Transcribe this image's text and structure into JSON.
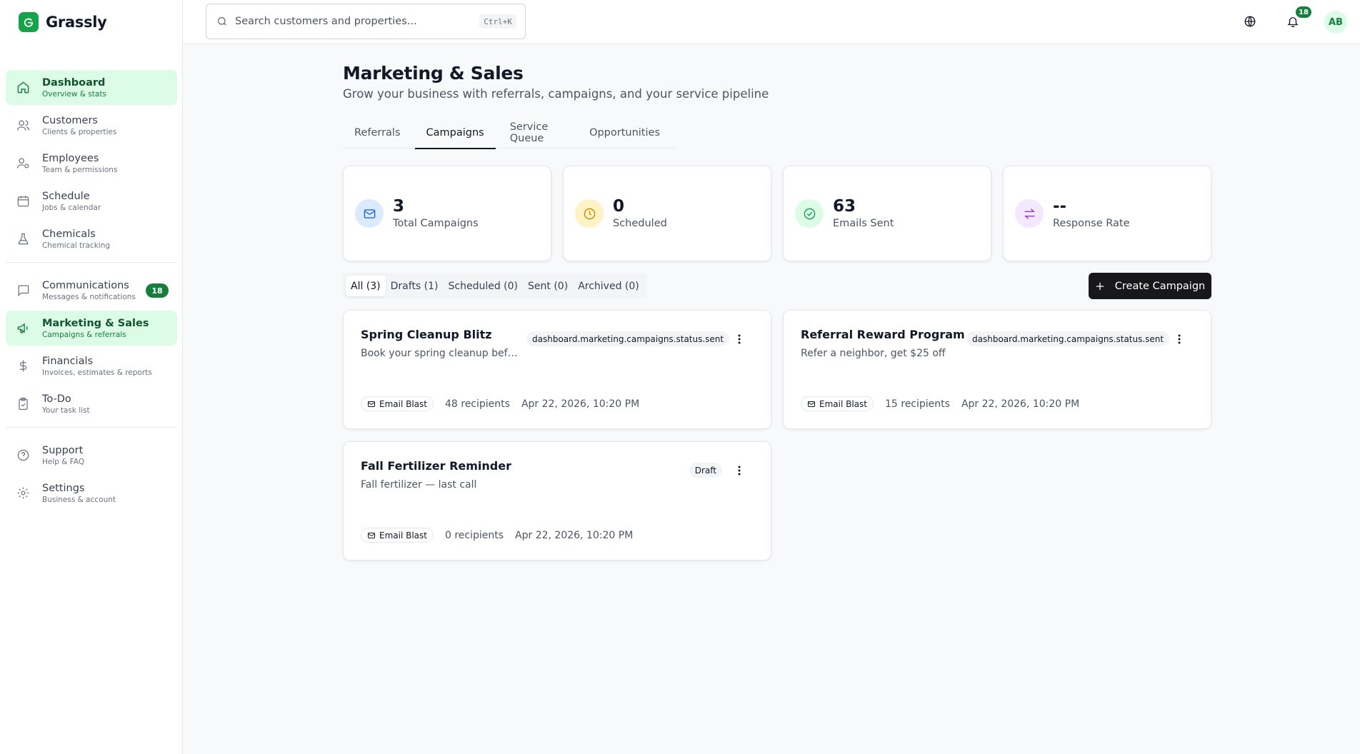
{
  "app": {
    "name": "Grassly"
  },
  "colors": {
    "brand": "#16a34a",
    "active_bg": "#dcfce7",
    "dark_button": "#18181b"
  },
  "search": {
    "placeholder": "Search customers and properties...",
    "shortcut": "Ctrl+K"
  },
  "topbar": {
    "notification_count": "18",
    "user_initials": "AB",
    "icons": [
      "globe-icon",
      "bell-icon"
    ]
  },
  "sidebar": {
    "items": [
      {
        "label": "Dashboard",
        "sub": "Overview & stats",
        "icon": "home-icon"
      },
      {
        "label": "Customers",
        "sub": "Clients & properties",
        "icon": "users-icon"
      },
      {
        "label": "Employees",
        "sub": "Team & permissions",
        "icon": "user-cog-icon"
      },
      {
        "label": "Schedule",
        "sub": "Jobs & calendar",
        "icon": "calendar-icon"
      },
      {
        "label": "Chemicals",
        "sub": "Chemical tracking",
        "icon": "flask-icon"
      },
      {
        "label": "Communications",
        "sub": "Messages & notifications",
        "icon": "message-icon",
        "badge": "18"
      },
      {
        "label": "Marketing & Sales",
        "sub": "Campaigns & referrals",
        "icon": "megaphone-icon"
      },
      {
        "label": "Financials",
        "sub": "Invoices, estimates & reports",
        "icon": "dollar-icon"
      },
      {
        "label": "To-Do",
        "sub": "Your task list",
        "icon": "clipboard-check-icon"
      },
      {
        "label": "Support",
        "sub": "Help & FAQ",
        "icon": "help-circle-icon"
      },
      {
        "label": "Settings",
        "sub": "Business & account",
        "icon": "gear-icon"
      }
    ]
  },
  "page": {
    "title": "Marketing & Sales",
    "subtitle": "Grow your business with referrals, campaigns, and your service pipeline",
    "tabs": [
      "Referrals",
      "Campaigns",
      "Service Queue",
      "Opportunities"
    ],
    "active_tab": "Campaigns"
  },
  "stats": [
    {
      "value": "3",
      "label": "Total Campaigns",
      "icon": "mail-icon"
    },
    {
      "value": "0",
      "label": "Scheduled",
      "icon": "clock-icon"
    },
    {
      "value": "63",
      "label": "Emails Sent",
      "icon": "check-circle-icon"
    },
    {
      "value": "--",
      "label": "Response Rate",
      "icon": "arrows-exchange-icon"
    }
  ],
  "filters": [
    "All (3)",
    "Drafts (1)",
    "Scheduled (0)",
    "Sent (0)",
    "Archived (0)"
  ],
  "active_filter": "All (3)",
  "create_button": "Create Campaign",
  "campaigns": [
    {
      "title": "Spring Cleanup Blitz",
      "description": "Book your spring cleanup befor...",
      "status": "dashboard.marketing.campaigns.status.sent",
      "type": "Email Blast",
      "recipients": "48 recipients",
      "date": "Apr 22, 2026, 10:20 PM"
    },
    {
      "title": "Referral Reward Program",
      "description": "Refer a neighbor, get $25 off",
      "status": "dashboard.marketing.campaigns.status.sent",
      "type": "Email Blast",
      "recipients": "15 recipients",
      "date": "Apr 22, 2026, 10:20 PM"
    },
    {
      "title": "Fall Fertilizer Reminder",
      "description": "Fall fertilizer — last call",
      "status": "Draft",
      "type": "Email Blast",
      "recipients": "0 recipients",
      "date": "Apr 22, 2026, 10:20 PM"
    }
  ]
}
